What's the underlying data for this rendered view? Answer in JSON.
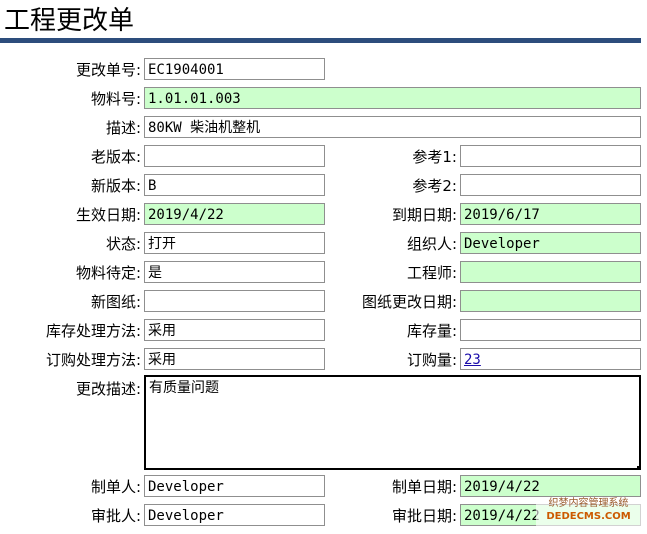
{
  "title": "工程更改单",
  "labels": {
    "doc_no": "更改单号:",
    "item_no": "物料号:",
    "desc": "描述:",
    "old_ver": "老版本:",
    "ref1": "参考1:",
    "new_ver": "新版本:",
    "ref2": "参考2:",
    "eff_date": "生效日期:",
    "exp_date": "到期日期:",
    "status": "状态:",
    "organizer": "组织人:",
    "item_pending": "物料待定:",
    "engineer": "工程师:",
    "new_drawing": "新图纸:",
    "drawing_change_date": "图纸更改日期:",
    "stock_method": "库存处理方法:",
    "stock_qty": "库存量:",
    "po_method": "订购处理方法:",
    "po_qty": "订购量:",
    "change_desc": "更改描述:",
    "creator": "制单人:",
    "create_date": "制单日期:",
    "approver": "审批人:",
    "approve_date": "审批日期:"
  },
  "values": {
    "doc_no": "EC1904001",
    "item_no": "1.01.01.003",
    "desc": "80KW 柴油机整机",
    "old_ver": "",
    "ref1": "",
    "new_ver": "B",
    "ref2": "",
    "eff_date": "2019/4/22",
    "exp_date": "2019/6/17",
    "status": "打开",
    "organizer": "Developer",
    "item_pending": "是",
    "engineer": "",
    "new_drawing": "",
    "drawing_change_date": "",
    "stock_method": "采用",
    "stock_qty": "",
    "po_method": "采用",
    "po_qty": "23",
    "change_desc": "有质量问题",
    "creator": "Developer",
    "create_date": "2019/4/22",
    "approver": "Developer",
    "approve_date": "2019/4/22"
  },
  "watermark": {
    "line1": "织梦内容管理系统",
    "line2": "DEDECMS.COM"
  },
  "colors": {
    "rule": "#2d4d7c",
    "readonly_field": "#ccffcc",
    "link": "#1a0dab"
  }
}
